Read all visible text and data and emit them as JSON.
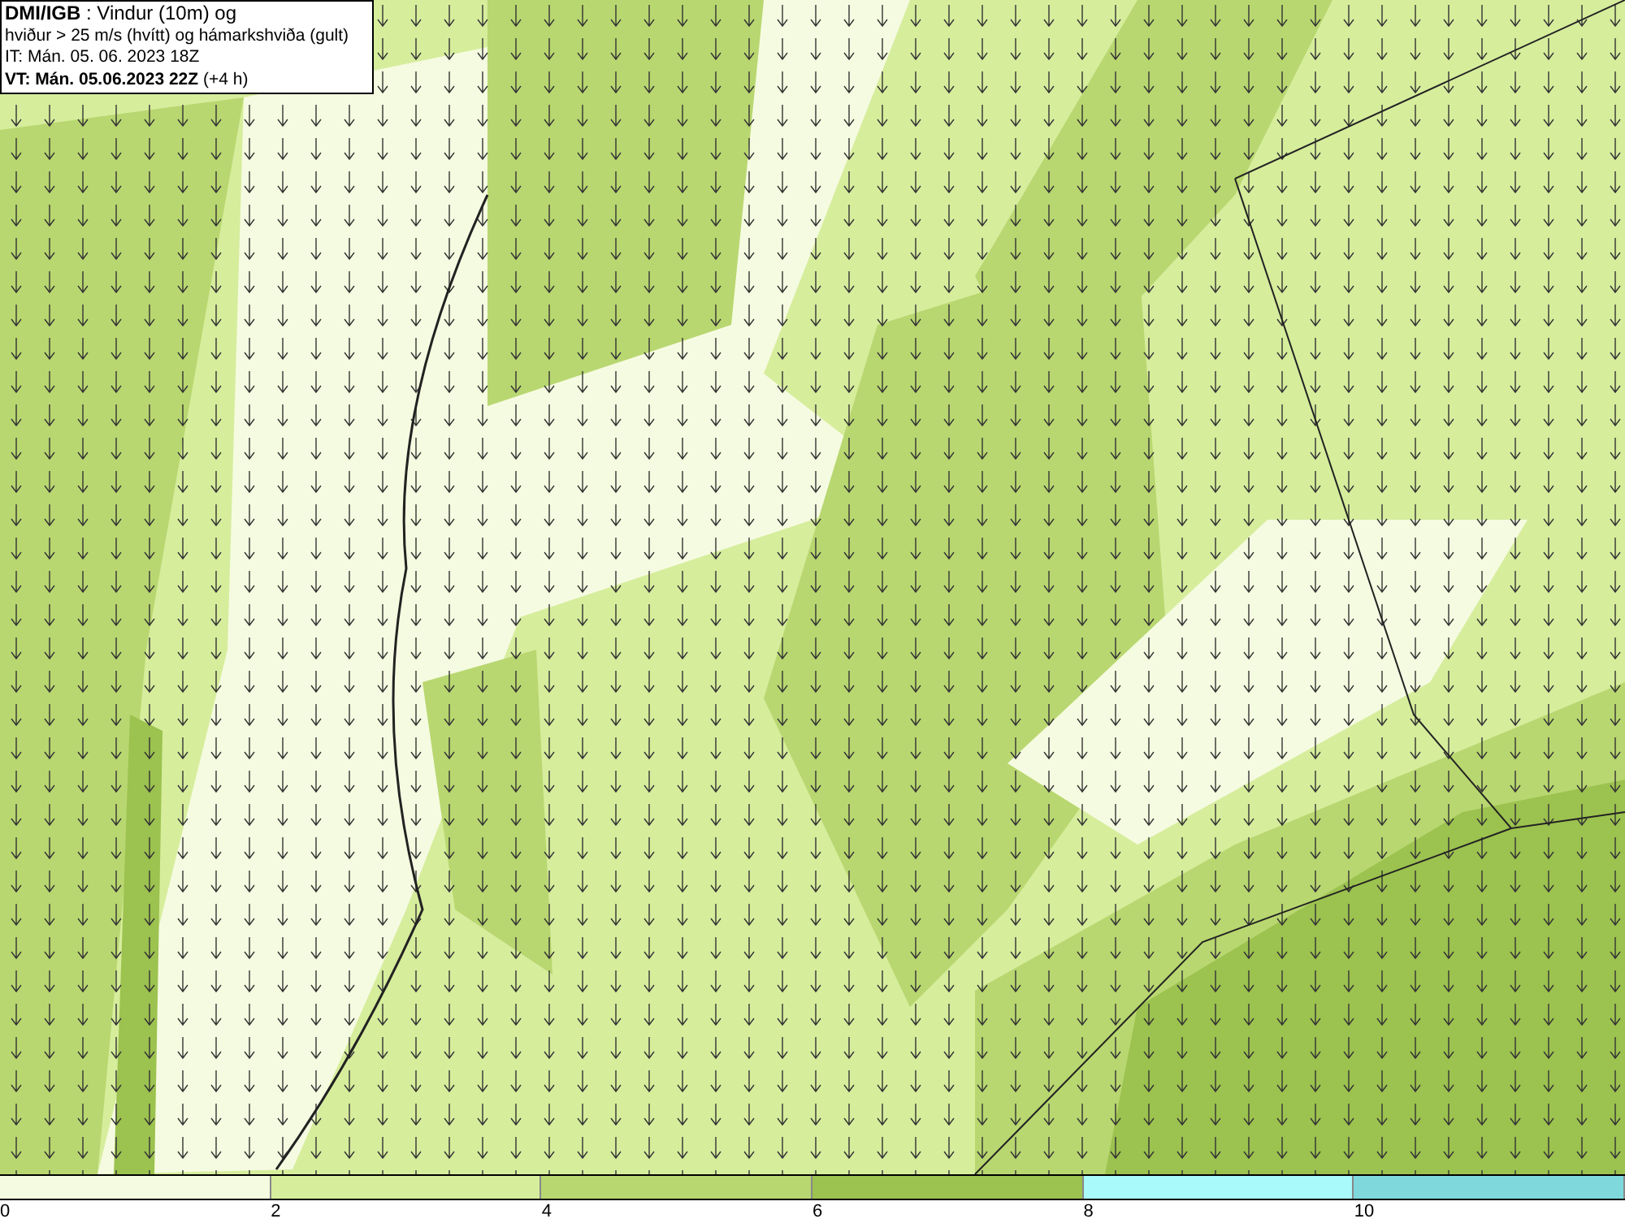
{
  "title_box": {
    "line_1": "**DMI/IGB** : Vindur (10m) og",
    "line_2": "hviður > 25 m/s (hvítt) og hámarkshviða (gult)",
    "line_3": "IT: Mán. 05. 06. 2023 18Z",
    "line_4": "**VT: Mán. 05.06.2023 22Z** (+4 h)"
  },
  "legend": {
    "bins": [
      {
        "color": "#f5fbe0"
      },
      {
        "color": "#d6ed9c"
      },
      {
        "color": "#b8d770"
      },
      {
        "color": "#9cc24f"
      },
      {
        "color": "#a9fafa"
      },
      {
        "color": "#7fd8dc"
      }
    ],
    "ticks": [
      "0",
      "2",
      "4",
      "6",
      "8",
      "10"
    ]
  }
}
